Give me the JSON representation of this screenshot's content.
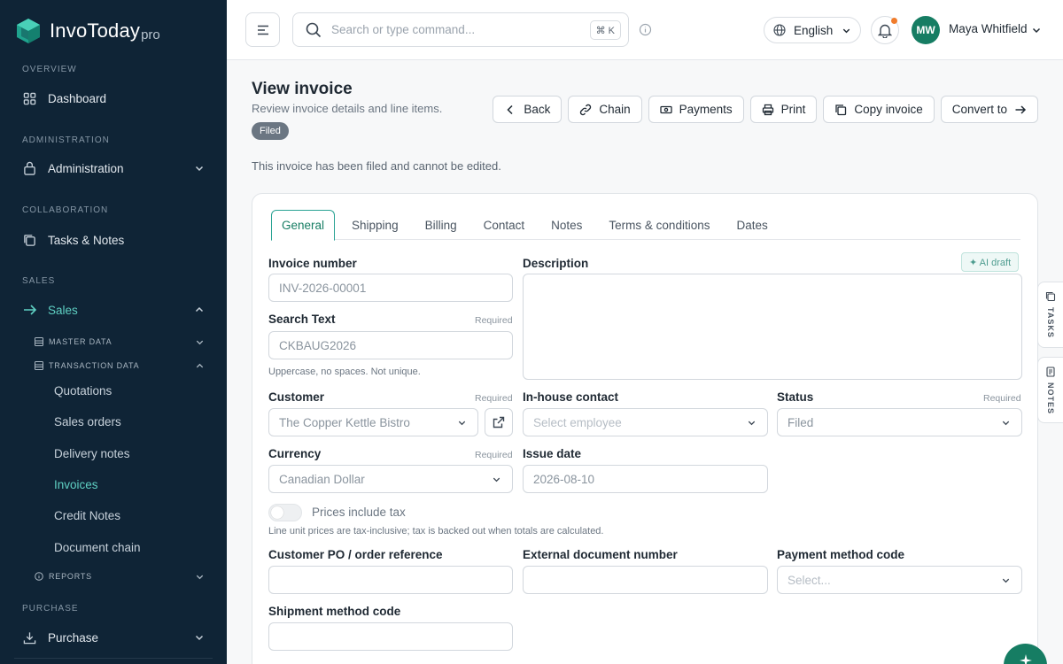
{
  "brand": {
    "name": "InvoToday",
    "suffix": "pro"
  },
  "sidebar": {
    "sections": {
      "overview": "OVERVIEW",
      "administration": "ADMINISTRATION",
      "collaboration": "COLLABORATION",
      "sales": "SALES",
      "purchase": "PURCHASE"
    },
    "items": {
      "dashboard": "Dashboard",
      "administration": "Administration",
      "tasks_notes": "Tasks & Notes",
      "sales": "Sales",
      "purchase": "Purchase"
    },
    "sub_groups": {
      "master_data": "MASTER DATA",
      "transaction_data": "TRANSACTION DATA",
      "reports": "REPORTS"
    },
    "leaves": [
      "Quotations",
      "Sales orders",
      "Delivery notes",
      "Invoices",
      "Credit Notes",
      "Document chain"
    ],
    "active_leaf": "Invoices"
  },
  "topbar": {
    "search_placeholder": "Search or type command...",
    "shortcut": "⌘ K",
    "language": "English",
    "user_initials": "MW",
    "user_name": "Maya Whitfield"
  },
  "page": {
    "title": "View invoice",
    "subtitle": "Review invoice details and line items.",
    "badge": "Filed",
    "notice": "This invoice has been filed and cannot be edited."
  },
  "actions": {
    "back": "Back",
    "chain": "Chain",
    "payments": "Payments",
    "print": "Print",
    "copy_invoice": "Copy invoice",
    "convert_to": "Convert to"
  },
  "tabs": [
    "General",
    "Shipping",
    "Billing",
    "Contact",
    "Notes",
    "Terms & conditions",
    "Dates"
  ],
  "active_tab": "General",
  "form": {
    "required_text": "Required",
    "invoice_number": {
      "label": "Invoice number",
      "value": "INV-2026-00001"
    },
    "description": {
      "label": "Description",
      "ai_chip": "✦ AI draft"
    },
    "search_text": {
      "label": "Search Text",
      "value": "CKBAUG2026",
      "help": "Uppercase, no spaces. Not unique."
    },
    "customer": {
      "label": "Customer",
      "value": "The Copper Kettle Bistro"
    },
    "inhouse_contact": {
      "label": "In-house contact",
      "placeholder": "Select employee"
    },
    "status": {
      "label": "Status",
      "value": "Filed"
    },
    "currency": {
      "label": "Currency",
      "value": "Canadian Dollar"
    },
    "issue_date": {
      "label": "Issue date",
      "value": "2026-08-10"
    },
    "prices_include_tax": {
      "label": "Prices include tax",
      "help": "Line unit prices are tax-inclusive; tax is backed out when totals are calculated.",
      "on": false
    },
    "customer_po": {
      "label": "Customer PO / order reference",
      "value": ""
    },
    "external_doc": {
      "label": "External document number",
      "value": ""
    },
    "payment_method": {
      "label": "Payment method code",
      "placeholder": "Select..."
    },
    "shipment_method": {
      "label": "Shipment method code",
      "value": ""
    }
  },
  "side_tabs": {
    "tasks": "TASKS",
    "notes": "NOTES"
  },
  "colors": {
    "sidebar_bg": "#0f2436",
    "accent": "#167d63",
    "accent_light": "#5fd0c3",
    "badge_bg": "#6b7682"
  }
}
